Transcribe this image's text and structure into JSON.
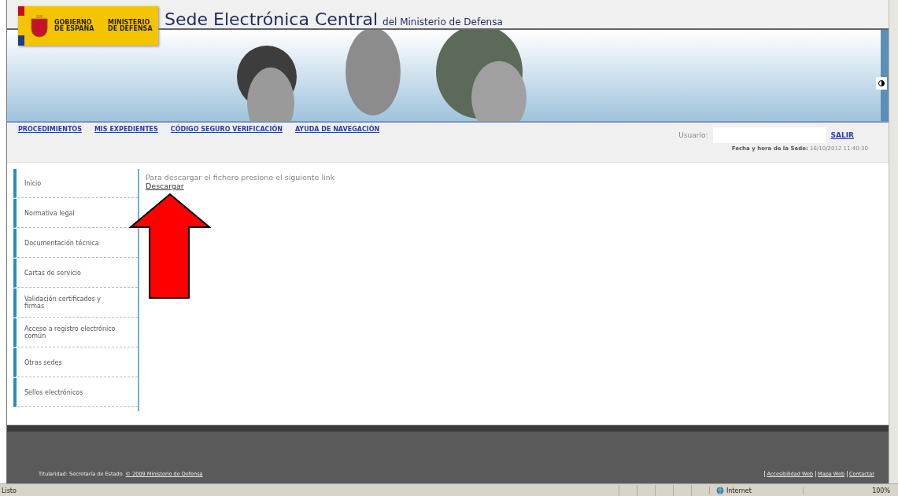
{
  "header": {
    "logo_lines": [
      "GOBIERNO DE ESPAÑA",
      "MINISTERIO DE DEFENSA"
    ],
    "title": "Sede Electrónica Central",
    "subtitle": "del Ministerio de Defensa",
    "banner": {
      "kind": "picture"
    }
  },
  "nav": {
    "links": [
      "PROCEDIMIENTOS",
      "MIS EXPEDIENTES",
      "CÓDIGO SEGURO VERIFICACIÓN",
      "AYUDA DE NAVEGACIÓN"
    ],
    "user_label": "Usuario:",
    "logout": "SALIR",
    "date_label": "Fecha y hora de la Sede:",
    "date_value": "16/10/2012 11:40:30"
  },
  "sidebar": {
    "items": [
      {
        "label": "Inicio"
      },
      {
        "label": "Normativa legal"
      },
      {
        "label": "Documentación técnica"
      },
      {
        "label": "Cartas de servicio"
      },
      {
        "label": "Validación certificados y firmas"
      },
      {
        "label": "Acceso a registro electrónico común"
      },
      {
        "label": "Otras sedes"
      },
      {
        "label": "Sellos electrónicos"
      }
    ]
  },
  "content": {
    "message": "Para descargar el fichero presione el siguiente link",
    "link": "Descargar"
  },
  "footer": {
    "owner": "Titularidad: Secretaría de Estado",
    "copyright": "© 2009 Ministerio de Defensa",
    "links": [
      "Accesibilidad Web",
      "Mapa Web",
      "Contactar"
    ]
  },
  "status_bar": {
    "status": "Listo",
    "zone": "Internet",
    "zoom": "100%"
  }
}
